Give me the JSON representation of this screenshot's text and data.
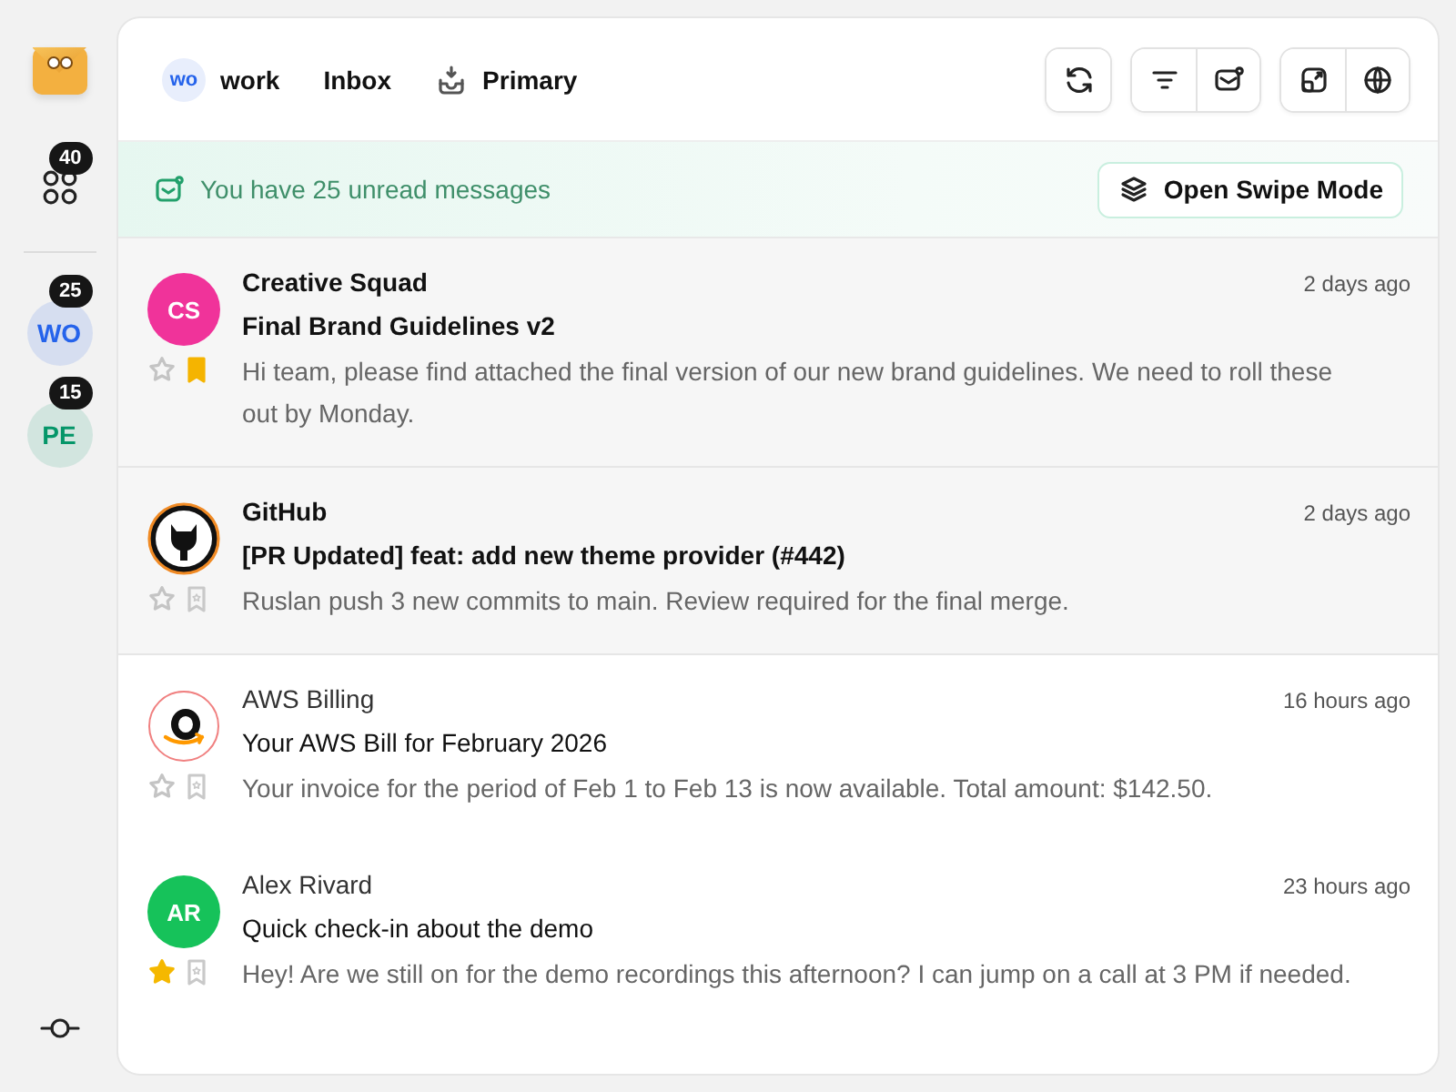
{
  "sidebar": {
    "apps_badge": "40",
    "accounts": [
      {
        "initials": "WO",
        "badge": "25",
        "color": "#2563eb"
      },
      {
        "initials": "PE",
        "badge": "15",
        "color": "#059669"
      }
    ]
  },
  "header": {
    "account": {
      "initials": "wo",
      "label": "work"
    },
    "folder": "Inbox",
    "category": "Primary"
  },
  "banner": {
    "message": "You have 25 unread messages",
    "button": "Open Swipe Mode"
  },
  "emails": [
    {
      "sender": "Creative Squad",
      "avatar": {
        "kind": "initials",
        "initials": "CS",
        "color": "#f0339a"
      },
      "subject": "Final Brand Guidelines v2",
      "preview": "Hi team, please find attached the final version of our new brand guidelines. We need to roll these out by Monday.",
      "time": "2 days ago",
      "unread": true,
      "starred": false,
      "bookmarked": true
    },
    {
      "sender": "GitHub",
      "avatar": {
        "kind": "github"
      },
      "subject": "[PR Updated] feat: add new theme provider (#442)",
      "preview": "Ruslan push 3 new commits to main. Review required for the final merge.",
      "time": "2 days ago",
      "unread": true,
      "starred": false,
      "bookmarked": false
    },
    {
      "sender": "AWS Billing",
      "avatar": {
        "kind": "amazon"
      },
      "subject": "Your AWS Bill for February 2026",
      "preview": "Your invoice for the period of Feb 1 to Feb 13 is now available. Total amount: $142.50.",
      "time": "16 hours ago",
      "unread": false,
      "starred": false,
      "bookmarked": false
    },
    {
      "sender": "Alex Rivard",
      "avatar": {
        "kind": "initials",
        "initials": "AR",
        "color": "#16c25a"
      },
      "subject": "Quick check-in about the demo",
      "preview": "Hey! Are we still on for the demo recordings this afternoon? I can jump on a call at 3 PM if needed.",
      "time": "23 hours ago",
      "unread": false,
      "starred": true,
      "bookmarked": false
    }
  ]
}
